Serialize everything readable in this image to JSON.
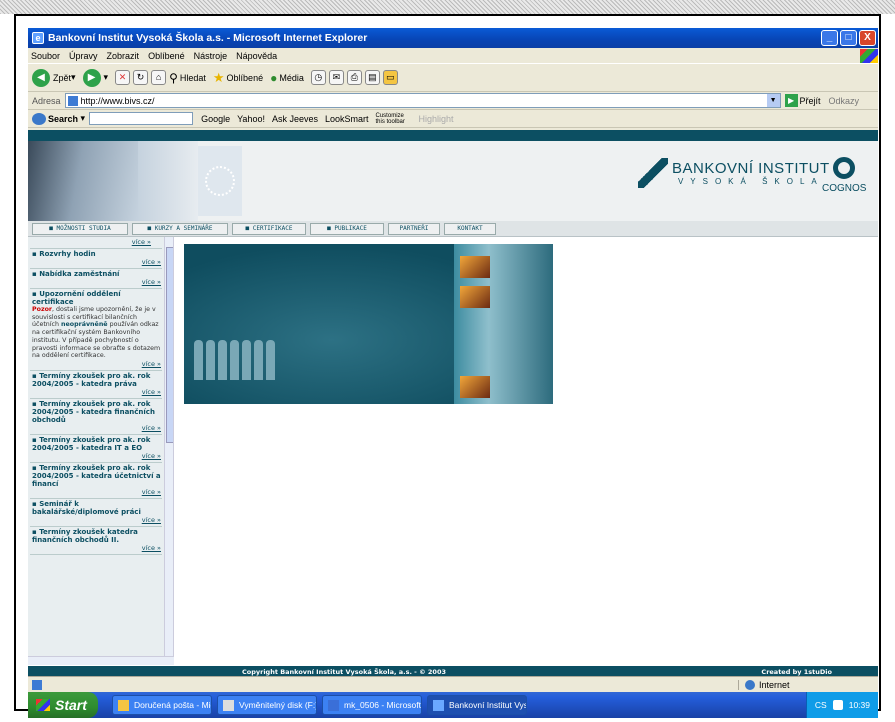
{
  "window": {
    "title": "Bankovní Institut Vysoká Škola a.s. - Microsoft Internet Explorer",
    "controls": [
      "_",
      "□",
      "X"
    ]
  },
  "menu": [
    "Soubor",
    "Úpravy",
    "Zobrazit",
    "Oblíbené",
    "Nástroje",
    "Nápověda"
  ],
  "toolbar": {
    "back": "Zpět",
    "search": "Hledat",
    "favorites": "Oblíbené",
    "media": "Média"
  },
  "address": {
    "label": "Adresa",
    "url": "http://www.bivs.cz/",
    "go": "Přejít",
    "links": "Odkazy"
  },
  "searchbar": {
    "label": "Search",
    "items": [
      "Google",
      "Yahoo!",
      "Ask Jeeves",
      "LookSmart",
      "Customize this toolbar",
      "Highlight"
    ]
  },
  "site": {
    "logo_main": "BANKOVNÍ INSTITUT",
    "logo_sub": "VYSOKÁ ŠKOLA",
    "partner": "COGNOS",
    "nav": [
      "MOŽNOSTI STUDIA",
      "KURZY A SEMINÁŘE",
      "CERTIFIKACE",
      "PUBLIKACE",
      "PARTNEŘI",
      "KONTAKT"
    ],
    "more": "více »",
    "news": [
      {
        "title": "Rozvrhy hodin"
      },
      {
        "title": "Nabídka zaměstnání"
      },
      {
        "title": "Upozornění oddělení certifikace",
        "body_red": "Pozor",
        "body_1": ", dostali jsme upozornění, že je v souvislosti s certifikací bilančních účetních",
        "body_blue": "neoprávněně",
        "body_2": " používán odkaz na certifikační systém Bankovního institutu. V případě pochybností o pravosti informace se obraťte s dotazem na oddělení certifikace."
      },
      {
        "title": "Termíny zkoušek pro ak. rok 2004/2005 - katedra práva"
      },
      {
        "title": "Termíny zkoušek pro ak. rok 2004/2005 - katedra finančních obchodů"
      },
      {
        "title": "Termíny zkoušek pro ak. rok 2004/2005 - katedra IT a EO"
      },
      {
        "title": "Termíny zkoušek pro ak. rok 2004/2005 - katedra účetnictví a financí"
      },
      {
        "title": "Seminář k bakalářské/diplomové práci"
      },
      {
        "title": "Termíny zkoušek katedra finančních obchodů II."
      }
    ],
    "footer_copy": "Copyright Bankovní Institut Vysoká Škola, a.s. - © 2003",
    "footer_credit": "Created by 1stuDio"
  },
  "status": {
    "zone": "Internet"
  },
  "taskbar": {
    "start": "Start",
    "tasks": [
      "Doručená pošta - Mic...",
      "Vyměnitelný disk (F:)",
      "mk_0506 - Microsoft ...",
      "Bankovní Institut Vys..."
    ],
    "lang": "CS",
    "clock": "10:39"
  },
  "colors": {
    "brand": "#0c4f62",
    "xp_blue": "#245edb",
    "start_green": "#2e8b2e"
  }
}
